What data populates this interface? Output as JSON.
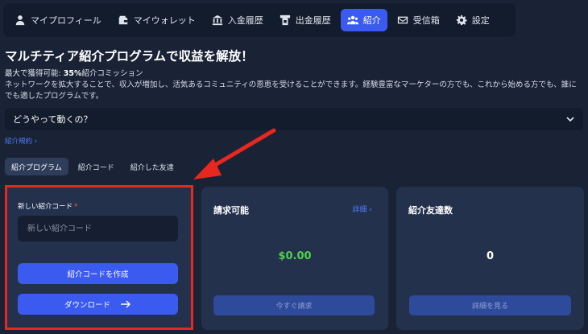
{
  "nav": [
    {
      "label": "マイプロフィール",
      "icon": "user-icon"
    },
    {
      "label": "マイウォレット",
      "icon": "wallet-icon"
    },
    {
      "label": "入金履歴",
      "icon": "deposit-icon"
    },
    {
      "label": "出金履歴",
      "icon": "withdraw-icon"
    },
    {
      "label": "紹介",
      "icon": "users-icon",
      "active": true
    },
    {
      "label": "受信箱",
      "icon": "mail-icon"
    },
    {
      "label": "設定",
      "icon": "gear-icon"
    }
  ],
  "headline": "マルチティア紹介プログラムで収益を解放！",
  "max_earn": {
    "prefix": "最大で獲得可能: ",
    "value": "35%",
    "suffix": "紹介コミッション"
  },
  "description": "ネットワークを拡大することで、収入が増加し、活気あるコミュニティの恩恵を受けることができます。経験豊富なマーケターの方でも、これから始める方でも、誰にでも適したプログラムです。",
  "faq": {
    "label": "どうやって動くの？"
  },
  "terms_link": "紹介規約 ›",
  "tabs": [
    "紹介プログラム",
    "紹介コード",
    "紹介した友達"
  ],
  "new_code": {
    "label": "新しい紹介コード",
    "required_mark": "*",
    "placeholder": "新しい紹介コード",
    "create_button": "紹介コードを作成",
    "download_button": "ダウンロード"
  },
  "claimable": {
    "title": "請求可能",
    "link": "詳細 ›",
    "amount": "$0.00",
    "button": "今すぐ請求"
  },
  "friends": {
    "title": "紹介友達数",
    "count": "0",
    "button": "詳細を見る"
  },
  "colors": {
    "accent": "#3b5bf0",
    "background": "#1a2336",
    "card": "#24314d",
    "amount_green": "#4fd14a",
    "highlight_red": "#e8271f"
  }
}
